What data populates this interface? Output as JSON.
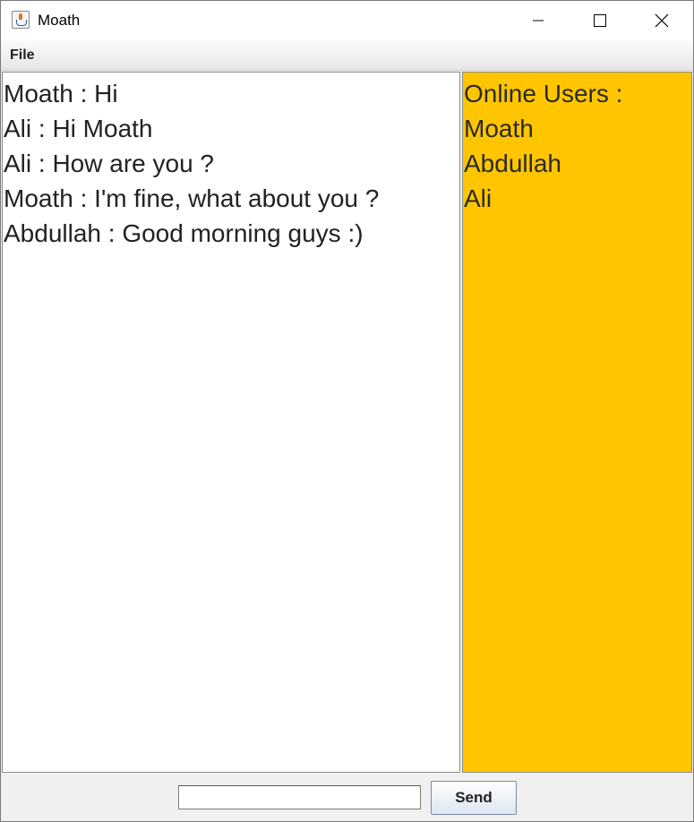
{
  "window": {
    "title": "Moath",
    "controls": {
      "minimize_icon": "minimize-icon",
      "maximize_icon": "maximize-icon",
      "close_icon": "close-icon"
    }
  },
  "menu": {
    "items": [
      {
        "label": "File"
      }
    ]
  },
  "chat": {
    "messages": [
      {
        "text": "Moath : Hi"
      },
      {
        "text": "Ali : Hi Moath"
      },
      {
        "text": "Ali : How are you ?"
      },
      {
        "text": "Moath : I'm fine, what about you ?"
      },
      {
        "text": "Abdullah : Good morning guys :)"
      }
    ]
  },
  "online_users": {
    "header": "Online Users :",
    "users": [
      {
        "name": "Moath"
      },
      {
        "name": "Abdullah"
      },
      {
        "name": "Ali"
      }
    ],
    "panel_color": "#ffc600"
  },
  "composer": {
    "input_value": "",
    "send_label": "Send"
  }
}
